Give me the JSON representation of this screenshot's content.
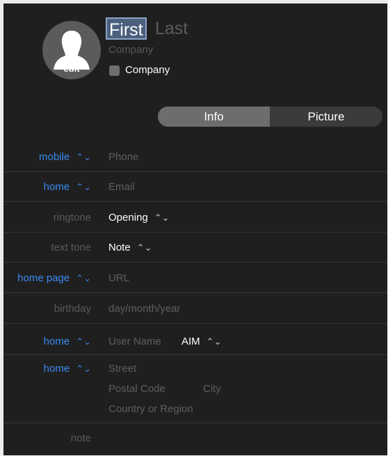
{
  "header": {
    "avatar_edit": "edit",
    "first_name": "First",
    "last_name": "Last",
    "company_placeholder": "Company",
    "company_checkbox_label": "Company"
  },
  "tabs": [
    {
      "label": "Info",
      "selected": true
    },
    {
      "label": "Picture",
      "selected": false
    }
  ],
  "fields": {
    "phone": {
      "label": "mobile",
      "placeholder": "Phone"
    },
    "email": {
      "label": "home",
      "placeholder": "Email"
    },
    "ringtone": {
      "label": "ringtone",
      "value": "Opening"
    },
    "text_tone": {
      "label": "text tone",
      "value": "Note"
    },
    "url": {
      "label": "home page",
      "placeholder": "URL"
    },
    "birthday": {
      "label": "birthday",
      "placeholder": "day/month/year"
    },
    "im": {
      "label": "home",
      "placeholder": "User Name",
      "service": "AIM"
    },
    "address": {
      "label": "home",
      "street": "Street",
      "postal_code": "Postal Code",
      "city": "City",
      "country": "Country or Region"
    },
    "note": {
      "label": "note"
    }
  },
  "icons": {
    "popup": "updown-chevron-icon",
    "avatar": "person-silhouette-icon"
  },
  "colors": {
    "background": "#1f1f1f",
    "accent_label": "#3b8bf0",
    "selected_name_fill": "#4b607d",
    "segment_selected": "#6d6d6d"
  }
}
